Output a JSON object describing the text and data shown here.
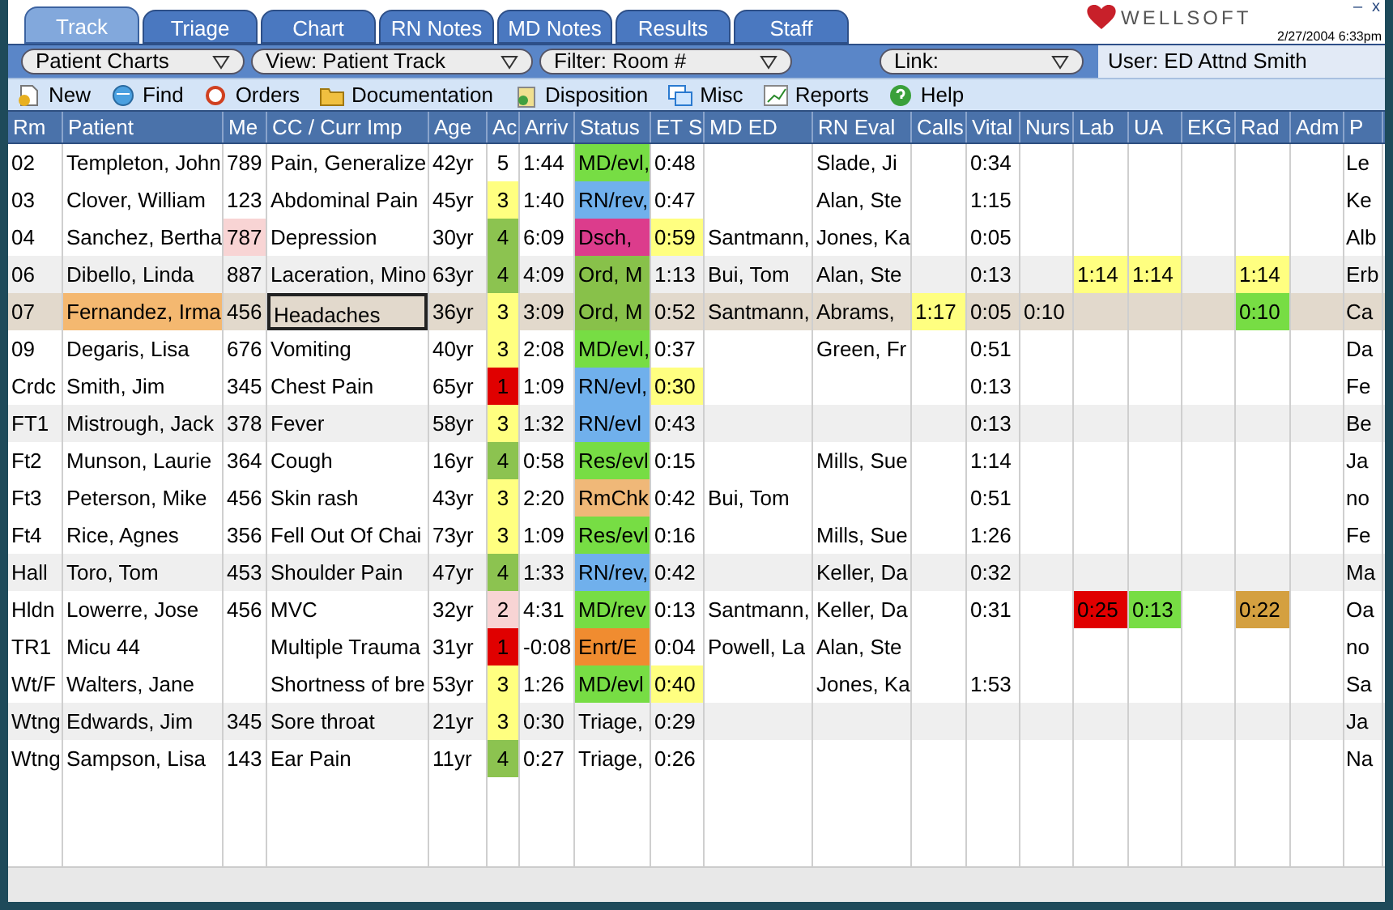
{
  "tabs": [
    {
      "label": "Track",
      "selected": true
    },
    {
      "label": "Triage",
      "selected": false
    },
    {
      "label": "Chart",
      "selected": false
    },
    {
      "label": "RN Notes",
      "selected": false
    },
    {
      "label": "MD Notes",
      "selected": false
    },
    {
      "label": "Results",
      "selected": false
    },
    {
      "label": "Staff",
      "selected": false
    }
  ],
  "logo": {
    "text": "WELLSOFT",
    "datetime": "2/27/2004 6:33pm",
    "minimize": "–",
    "close": "x"
  },
  "filters": [
    {
      "label": "Patient Charts"
    },
    {
      "label": "View: Patient Track"
    },
    {
      "label": "Filter: Room #"
    }
  ],
  "link": {
    "label": "Link:"
  },
  "user": "User: ED Attnd Smith",
  "toolbar": [
    {
      "kind": "new",
      "label": "New"
    },
    {
      "kind": "find",
      "label": "Find"
    },
    {
      "kind": "orders",
      "label": "Orders"
    },
    {
      "kind": "documentation",
      "label": "Documentation"
    },
    {
      "kind": "disposition",
      "label": "Disposition"
    },
    {
      "kind": "misc",
      "label": "Misc"
    },
    {
      "kind": "reports",
      "label": "Reports"
    },
    {
      "kind": "help",
      "label": "Help"
    }
  ],
  "table": {
    "columns": [
      "Rm",
      "Patient",
      "Me",
      "CC / Curr Imp",
      "Age",
      "Ac",
      "Arriv",
      "Status",
      "ET S",
      "MD ED",
      "RN Eval",
      "Calls",
      "Vital",
      "Nurs",
      "Lab",
      "UA",
      "EKG",
      "Rad",
      "Adm",
      "P"
    ],
    "rows": [
      {
        "selected": false,
        "cells": [
          "02",
          "Templeton, John",
          "789",
          "Pain, Generalize",
          "42yr",
          "5",
          "1:44",
          {
            "text": "MD/evl,",
            "color": "#77dd44"
          },
          "0:48",
          null,
          "Slade, Ji",
          null,
          "0:34",
          null,
          null,
          null,
          null,
          null,
          null,
          "Le"
        ]
      },
      {
        "selected": false,
        "cells": [
          "03",
          "Clover, William",
          "123",
          "Abdominal Pain",
          "45yr",
          {
            "text": "3",
            "color": "#ffff80"
          },
          "1:40",
          {
            "text": "RN/rev,",
            "color": "#70b0ec"
          },
          "0:47",
          null,
          "Alan, Ste",
          null,
          "1:15",
          null,
          null,
          null,
          null,
          null,
          null,
          "Ke"
        ]
      },
      {
        "selected": false,
        "cells": [
          "04",
          "Sanchez, Bertha",
          {
            "text": "787",
            "color": "#f8d4d4"
          },
          "Depression",
          "30yr",
          {
            "text": "4",
            "color": "#8cc350"
          },
          "6:09",
          {
            "text": "Dsch,",
            "color": "#dc3c8c"
          },
          {
            "text": "0:59",
            "color": "#ffff80"
          },
          "Santmann,",
          "Jones, Ka",
          null,
          "0:05",
          null,
          null,
          null,
          null,
          null,
          null,
          "Alb"
        ]
      },
      {
        "selected": false,
        "cells": [
          "06",
          "Dibello, Linda",
          "887",
          "Laceration, Mino",
          "63yr",
          {
            "text": "4",
            "color": "#8cc350"
          },
          "4:09",
          {
            "text": "Ord, M",
            "color": "#88c14a"
          },
          "1:13",
          "Bui, Tom",
          "Alan, Ste",
          null,
          "0:13",
          null,
          {
            "text": "1:14",
            "color": "#ffff80"
          },
          {
            "text": "1:14",
            "color": "#ffff80"
          },
          null,
          {
            "text": "1:14",
            "color": "#ffff80"
          },
          null,
          "Erb"
        ]
      },
      {
        "selected": true,
        "cells": [
          "07",
          {
            "text": "Fernandez, Irma",
            "color": "#f4b870"
          },
          "456",
          {
            "text": "Headaches",
            "focused": true
          },
          "36yr",
          {
            "text": "3",
            "color": "#ffff80"
          },
          "3:09",
          {
            "text": "Ord, M",
            "color": "#88c14a"
          },
          "0:52",
          "Santmann,",
          "Abrams,",
          {
            "text": "1:17",
            "color": "#ffff80"
          },
          "0:05",
          "0:10",
          null,
          null,
          null,
          {
            "text": "0:10",
            "color": "#77dd44"
          },
          null,
          "Ca"
        ]
      },
      {
        "selected": false,
        "cells": [
          "09",
          "Degaris, Lisa",
          "676",
          "Vomiting",
          "40yr",
          {
            "text": "3",
            "color": "#ffff80"
          },
          "2:08",
          {
            "text": "MD/evl,",
            "color": "#77dd44"
          },
          "0:37",
          null,
          "Green, Fr",
          null,
          "0:51",
          null,
          null,
          null,
          null,
          null,
          null,
          "Da"
        ]
      },
      {
        "selected": false,
        "cells": [
          "Crdc",
          "Smith, Jim",
          "345",
          "Chest Pain",
          "65yr",
          {
            "text": "1",
            "color": "#e00000"
          },
          "1:09",
          {
            "text": "RN/evl,",
            "color": "#70b0ec"
          },
          {
            "text": "0:30",
            "color": "#ffff80"
          },
          null,
          null,
          null,
          "0:13",
          null,
          null,
          null,
          null,
          null,
          null,
          "Fe"
        ]
      },
      {
        "selected": false,
        "cells": [
          "FT1",
          "Mistrough, Jack",
          "378",
          "Fever",
          "58yr",
          {
            "text": "3",
            "color": "#ffff80"
          },
          "1:32",
          {
            "text": "RN/evl",
            "color": "#70b0ec"
          },
          "0:43",
          null,
          null,
          null,
          "0:13",
          null,
          null,
          null,
          null,
          null,
          null,
          "Be"
        ]
      },
      {
        "selected": false,
        "cells": [
          "Ft2",
          "Munson, Laurie",
          "364",
          "Cough",
          "16yr",
          {
            "text": "4",
            "color": "#8cc350"
          },
          "0:58",
          {
            "text": "Res/evl",
            "color": "#77dd44"
          },
          "0:15",
          null,
          "Mills, Sue",
          null,
          "1:14",
          null,
          null,
          null,
          null,
          null,
          null,
          "Ja"
        ]
      },
      {
        "selected": false,
        "cells": [
          "Ft3",
          "Peterson, Mike",
          "456",
          "Skin rash",
          "43yr",
          {
            "text": "3",
            "color": "#ffff80"
          },
          "2:20",
          {
            "text": "RmChk",
            "color": "#f0b878"
          },
          "0:42",
          "Bui, Tom",
          null,
          null,
          "0:51",
          null,
          null,
          null,
          null,
          null,
          null,
          "no"
        ]
      },
      {
        "selected": false,
        "cells": [
          "Ft4",
          "Rice, Agnes",
          "356",
          "Fell Out Of Chai",
          "73yr",
          {
            "text": "3",
            "color": "#ffff80"
          },
          "1:09",
          {
            "text": "Res/evl",
            "color": "#77dd44"
          },
          "0:16",
          null,
          "Mills, Sue",
          null,
          "1:26",
          null,
          null,
          null,
          null,
          null,
          null,
          "Fe"
        ]
      },
      {
        "selected": false,
        "cells": [
          "Hall",
          "Toro, Tom",
          "453",
          "Shoulder Pain",
          "47yr",
          {
            "text": "4",
            "color": "#8cc350"
          },
          "1:33",
          {
            "text": "RN/rev,",
            "color": "#70b0ec"
          },
          "0:42",
          null,
          "Keller, Da",
          null,
          "0:32",
          null,
          null,
          null,
          null,
          null,
          null,
          "Ma"
        ]
      },
      {
        "selected": false,
        "cells": [
          "Hldn",
          "Lowerre, Jose",
          "456",
          "MVC",
          "32yr",
          {
            "text": "2",
            "color": "#f8d4d4"
          },
          "4:31",
          {
            "text": "MD/rev",
            "color": "#77dd44"
          },
          "0:13",
          "Santmann,",
          "Keller, Da",
          null,
          "0:31",
          null,
          {
            "text": "0:25",
            "color": "#e00000"
          },
          {
            "text": "0:13",
            "color": "#77dd44"
          },
          null,
          {
            "text": "0:22",
            "color": "#d4a040"
          },
          null,
          "Oa"
        ]
      },
      {
        "selected": false,
        "cells": [
          "TR1",
          "Micu 44",
          null,
          "Multiple Trauma",
          "31yr",
          {
            "text": "1",
            "color": "#e00000"
          },
          "-0:08",
          {
            "text": "Enrt/E",
            "color": "#f08c30"
          },
          "0:04",
          "Powell, La",
          "Alan, Ste",
          null,
          null,
          null,
          null,
          null,
          null,
          null,
          null,
          "no"
        ]
      },
      {
        "selected": false,
        "cells": [
          "Wt/F",
          "Walters, Jane",
          null,
          "Shortness of bre",
          "53yr",
          {
            "text": "3",
            "color": "#ffff80"
          },
          "1:26",
          {
            "text": "MD/evl",
            "color": "#77dd44"
          },
          {
            "text": "0:40",
            "color": "#ffff80"
          },
          null,
          "Jones, Ka",
          null,
          "1:53",
          null,
          null,
          null,
          null,
          null,
          null,
          "Sa"
        ]
      },
      {
        "selected": false,
        "cells": [
          "Wtng",
          "Edwards, Jim",
          "345",
          "Sore throat",
          "21yr",
          {
            "text": "3",
            "color": "#ffff80"
          },
          "0:30",
          "Triage,",
          "0:29",
          null,
          null,
          null,
          null,
          null,
          null,
          null,
          null,
          null,
          null,
          "Ja"
        ]
      },
      {
        "selected": false,
        "cells": [
          "Wtng",
          "Sampson, Lisa",
          "143",
          "Ear Pain",
          "11yr",
          {
            "text": "4",
            "color": "#8cc350"
          },
          "0:27",
          "Triage,",
          "0:26",
          null,
          null,
          null,
          null,
          null,
          null,
          null,
          null,
          null,
          null,
          "Na"
        ]
      }
    ]
  }
}
